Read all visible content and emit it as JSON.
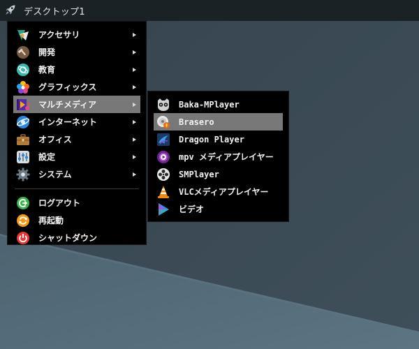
{
  "taskbar": {
    "title": "デスクトップ1",
    "launcher_icon": "rocket-icon"
  },
  "main_menu": {
    "categories": [
      {
        "label": "アクセサリ",
        "icon": "accessories-icon",
        "color": "#2aa08a"
      },
      {
        "label": "開発",
        "icon": "development-icon",
        "color": "#7a5a44"
      },
      {
        "label": "教育",
        "icon": "education-icon",
        "color": "#3db6b0"
      },
      {
        "label": "グラフィックス",
        "icon": "graphics-icon",
        "color": "#e0498a"
      },
      {
        "label": "マルチメディア",
        "icon": "multimedia-icon",
        "color": "#8a3cc8"
      },
      {
        "label": "インターネット",
        "icon": "internet-icon",
        "color": "#2e86d6"
      },
      {
        "label": "オフィス",
        "icon": "office-icon",
        "color": "#b07a3c"
      },
      {
        "label": "設定",
        "icon": "settings-icon",
        "color": "#d8dce0"
      },
      {
        "label": "システム",
        "icon": "system-icon",
        "color": "#6b7a86"
      }
    ],
    "session": [
      {
        "label": "ログアウト",
        "icon": "logout-icon",
        "color": "#3bb34a"
      },
      {
        "label": "再起動",
        "icon": "reboot-icon",
        "color": "#f39a1e"
      },
      {
        "label": "シャットダウン",
        "icon": "shutdown-icon",
        "color": "#e23b3b"
      }
    ]
  },
  "multimedia_menu": {
    "items": [
      {
        "label": "Baka-MPlayer",
        "icon": "baka-mplayer-icon"
      },
      {
        "label": "Brasero",
        "icon": "brasero-icon"
      },
      {
        "label": "Dragon Player",
        "icon": "dragon-player-icon"
      },
      {
        "label": "mpv メディアプレイヤー",
        "icon": "mpv-icon"
      },
      {
        "label": "SMPlayer",
        "icon": "smplayer-icon"
      },
      {
        "label": "VLCメディアプレイヤー",
        "icon": "vlc-icon"
      },
      {
        "label": "ビデオ",
        "icon": "video-icon"
      }
    ]
  },
  "colors": {
    "desktop_light": "#58707f",
    "desktop_dark": "#2d3a44",
    "taskbar": "#1b2226",
    "menu_bg": "#000000",
    "highlight": "#787878"
  }
}
